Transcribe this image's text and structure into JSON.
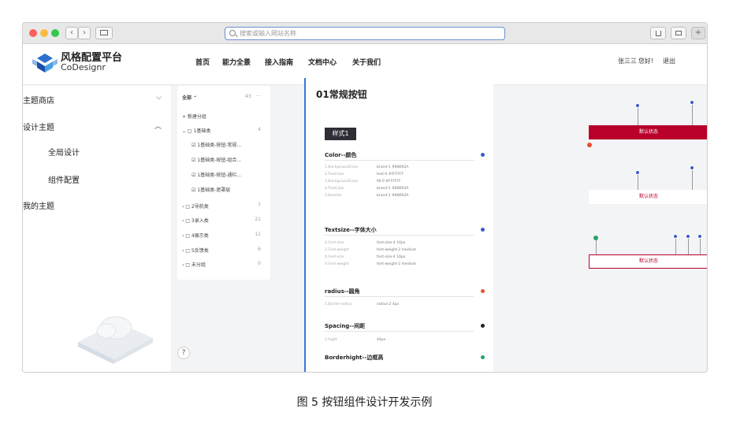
{
  "browser": {
    "back_label": "‹",
    "forward_label": "›",
    "url_placeholder": "搜索或输入网站名称",
    "share_icon": "share-icon",
    "tabs_icon": "tabs-icon",
    "plus_label": "+"
  },
  "app": {
    "brand_cn": "风格配置平台",
    "brand_en": "CoDesignr",
    "nav": [
      "首页",
      "能力全景",
      "接入指南",
      "文档中心",
      "关于我们"
    ],
    "active_nav": "文档中心",
    "user": "张三三",
    "greeting": "您好!",
    "logout": "退出"
  },
  "sidebar": {
    "items": [
      {
        "label": "主题商店",
        "chevron": "⌵"
      },
      {
        "label": "设计主题",
        "chevron": "︿"
      },
      {
        "label": "全局设计"
      },
      {
        "label": "组件配置"
      },
      {
        "label": "我的主题"
      }
    ]
  },
  "tree": {
    "header": "全部 ⌃",
    "header_count": "43",
    "header_more": "···",
    "new_group": "+ 新建分组",
    "rows": [
      {
        "label": "⌄ □ 1基础类",
        "count": "4"
      },
      {
        "label": "☑ 1基础类-按钮-常规...",
        "count": ""
      },
      {
        "label": "☑ 1基础类-按钮-组合...",
        "count": ""
      },
      {
        "label": "☑ 1基础类-按钮-通栏...",
        "count": ""
      },
      {
        "label": "☑ 1基础类-遮罩层",
        "count": ""
      },
      {
        "label": "› □ 2导航类",
        "count": "7"
      },
      {
        "label": "› □ 3录入类",
        "count": "21"
      },
      {
        "label": "› □ 4展示类",
        "count": "11"
      },
      {
        "label": "› □ 5反馈类",
        "count": "6"
      },
      {
        "label": "› □ 未分组",
        "count": "0"
      }
    ],
    "help": "?"
  },
  "doc": {
    "title": "01常规按钮",
    "style_tag": "样式1",
    "sections": [
      {
        "title": "Color--颜色",
        "color": "#3a5bc7",
        "props": [
          [
            "1.BackgroundColor",
            "brand-1  #B8002A"
          ],
          [
            "2.TextColor",
            "text-0  #FFFFFF"
          ],
          [
            "3.BackgroundColor",
            "fill-0  #FFFFFF"
          ],
          [
            "4.TextColor",
            "brand-1  #B8002A"
          ],
          [
            "5.Boarder",
            "brand-1  #B8002A"
          ]
        ]
      },
      {
        "title": "Textsize--字体大小",
        "color": "#3a5bc7",
        "props": [
          [
            "2.Font-size",
            "font-size-4  16px"
          ],
          [
            "2.Font-weight",
            "font-weight-2  medium"
          ],
          [
            "4.Font-size",
            "font-size-4  16px"
          ],
          [
            "4.Font-weight",
            "font-weight-2  medium"
          ]
        ]
      },
      {
        "title": "radius--圆角",
        "color": "#e8502c",
        "props": [
          [
            "1.Border-radius",
            "radius-2  4px"
          ]
        ]
      },
      {
        "title": "Spacing--间距",
        "color": "#222222",
        "props": [
          [
            "1.hight",
            "44px"
          ]
        ]
      },
      {
        "title": "Borderhight--边框高",
        "color": "#27a36b",
        "props": []
      }
    ]
  },
  "preview": {
    "buttons": [
      "默认状态",
      "默认状态",
      "默认状态"
    ],
    "brand_color": "#B8002A"
  },
  "caption": "图 5  按钮组件设计开发示例"
}
